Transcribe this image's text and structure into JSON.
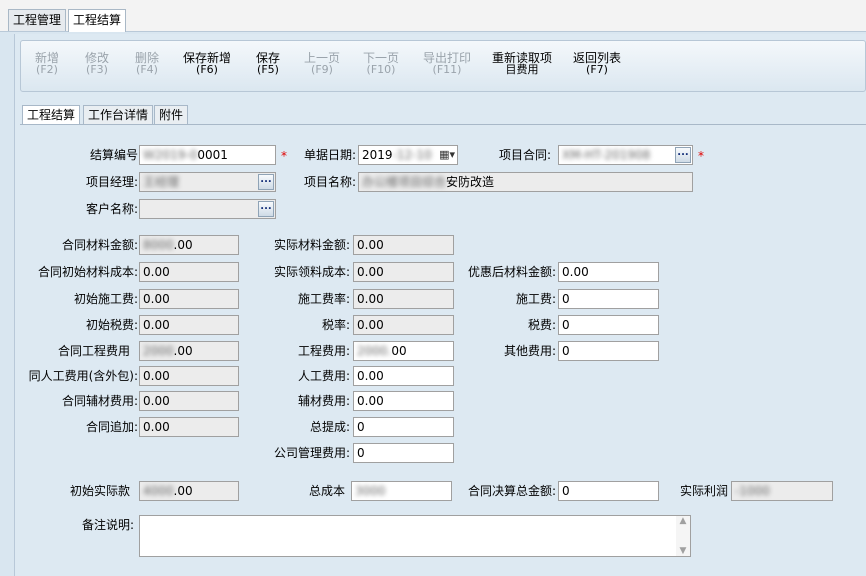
{
  "top_tabs": [
    "工程管理",
    "工程结算"
  ],
  "toolbar": [
    {
      "label": "新增",
      "key": "(F2)",
      "enabled": false
    },
    {
      "label": "修改",
      "key": "(F3)",
      "enabled": false
    },
    {
      "label": "删除",
      "key": "(F4)",
      "enabled": false
    },
    {
      "label": "保存新增",
      "key": "(F6)",
      "enabled": true
    },
    {
      "label": "保存",
      "key": "(F5)",
      "enabled": true
    },
    {
      "label": "上一页",
      "key": "(F9)",
      "enabled": false
    },
    {
      "label": "下一页",
      "key": "(F10)",
      "enabled": false
    },
    {
      "label": "导出打印",
      "key": "(F11)",
      "enabled": false
    },
    {
      "label": "重新读取项",
      "key": "目费用",
      "enabled": true
    },
    {
      "label": "返回列表",
      "key": "(F7)",
      "enabled": true
    }
  ],
  "sub_tabs": [
    "工程结算",
    "工作台详情",
    "附件"
  ],
  "form": {
    "settle_no_label": "结算编号",
    "settle_no_value": "0001",
    "bill_date_label": "单据日期:",
    "bill_date_value": "2019",
    "contract_label": "项目合同:",
    "manager_label": "项目经理:",
    "project_name_label": "项目名称:",
    "project_name_value": "安防改造",
    "customer_label": "客户名称:",
    "required_mark": "*",
    "ellipsis": "...",
    "contract_material_label": "合同材料金额:",
    "contract_material_value": ".00",
    "actual_material_label": "实际材料金额:",
    "actual_material_value": "0.00",
    "init_material_cost_label": "合同初始材料成本:",
    "init_material_cost_value": "0.00",
    "actual_issue_cost_label": "实际领料成本:",
    "actual_issue_cost_value": "0.00",
    "discounted_material_label": "优惠后材料金额:",
    "discounted_material_value": "0.00",
    "init_construction_fee_label": "初始施工费:",
    "init_construction_fee_value": "0.00",
    "construction_rate_label": "施工费率:",
    "construction_rate_value": "0.00",
    "construction_fee_label": "施工费:",
    "construction_fee_value": "0",
    "init_tax_label": "初始税费:",
    "init_tax_value": "0.00",
    "tax_rate_label": "税率:",
    "tax_rate_value": "0.00",
    "tax_label": "税费:",
    "tax_value": "0",
    "contract_eng_fee_label": "合同工程费用",
    "contract_eng_fee_value": ".00",
    "eng_fee_label": "工程费用:",
    "eng_fee_value": "00",
    "other_fee_label": "其他费用:",
    "other_fee_value": "0",
    "contract_labor_label": "同人工费用(含外包):",
    "contract_labor_value": "0.00",
    "labor_label": "人工费用:",
    "labor_value": "0.00",
    "contract_aux_label": "合同辅材费用:",
    "contract_aux_value": "0.00",
    "aux_label": "辅材费用:",
    "aux_value": "0.00",
    "contract_add_label": "合同追加:",
    "contract_add_value": "0.00",
    "commission_label": "总提成:",
    "commission_value": "0",
    "mgmt_fee_label": "公司管理费用:",
    "mgmt_fee_value": "0",
    "init_actual_label": "初始实际款",
    "init_actual_value": ".00",
    "total_cost_label": "总成本",
    "final_total_label": "合同决算总金额:",
    "final_total_value": "0",
    "actual_profit_label": "实际利润",
    "remark_label": "备注说明:"
  }
}
